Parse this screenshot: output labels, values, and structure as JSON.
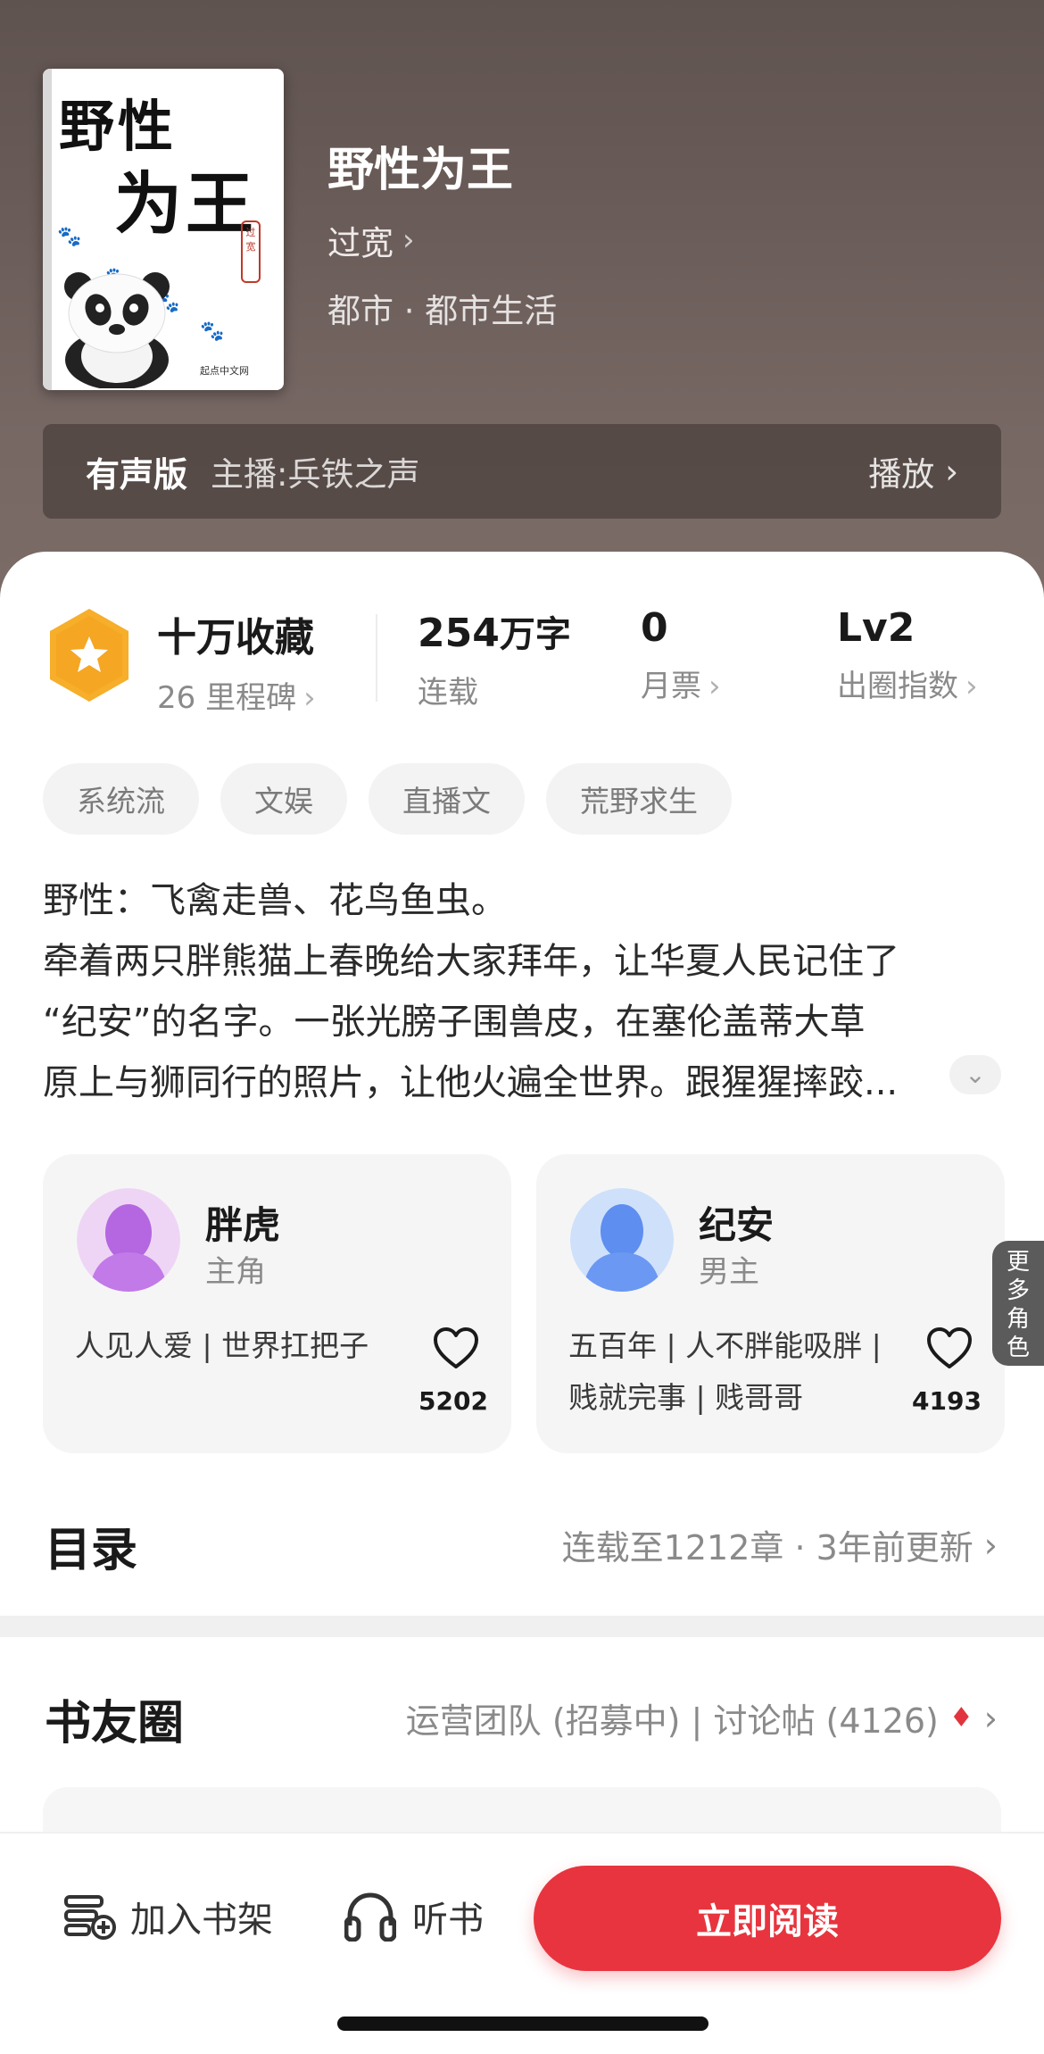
{
  "book": {
    "cover_title_line1": "野性",
    "cover_title_line2": "为王",
    "cover_stamp": "过宽",
    "cover_publisher": "起点中文网",
    "title": "野性为王",
    "author": "过宽",
    "genre": "都市 · 都市生活"
  },
  "audio": {
    "tag": "有声版",
    "host_label": "主播:",
    "host": "兵铁之声",
    "play_label": "播放"
  },
  "stats": {
    "collection": "十万收藏",
    "milestone": "26 里程碑",
    "word_count_number": "254",
    "word_count_unit": "万字",
    "status": "连载",
    "monthly_ticket_count": "0",
    "monthly_ticket_label": "月票",
    "level": "Lv2",
    "level_label": "出圈指数"
  },
  "tags": [
    "系统流",
    "文娱",
    "直播文",
    "荒野求生"
  ],
  "synopsis": [
    "野性：飞禽走兽、花鸟鱼虫。",
    "牵着两只胖熊猫上春晚给大家拜年，让华夏人民记住了",
    "“纪安”的名字。一张光膀子围兽皮，在塞伦盖蒂大草",
    "原上与狮同行的照片，让他火遍全世界。跟猩猩摔跤..."
  ],
  "characters": [
    {
      "name": "胖虎",
      "role": "主角",
      "desc": "人见人爱 | 世界扛把子",
      "likes": "5202"
    },
    {
      "name": "纪安",
      "role": "男主",
      "desc": "五百年 | 人不胖能吸胖 | 贱就完事 | 贱哥哥",
      "likes": "4193"
    }
  ],
  "more_roles": "更多角色",
  "toc": {
    "title": "目录",
    "info": "连载至1212章 · 3年前更新"
  },
  "circle": {
    "title": "书友圈",
    "info": "运营团队 (招募中) | 讨论帖 (4126)"
  },
  "bottom": {
    "shelf": "加入书架",
    "listen": "听书",
    "read": "立即阅读"
  },
  "colors": {
    "accent": "#e8343e",
    "medal": "#f5a623",
    "header": "#6a5c58"
  }
}
